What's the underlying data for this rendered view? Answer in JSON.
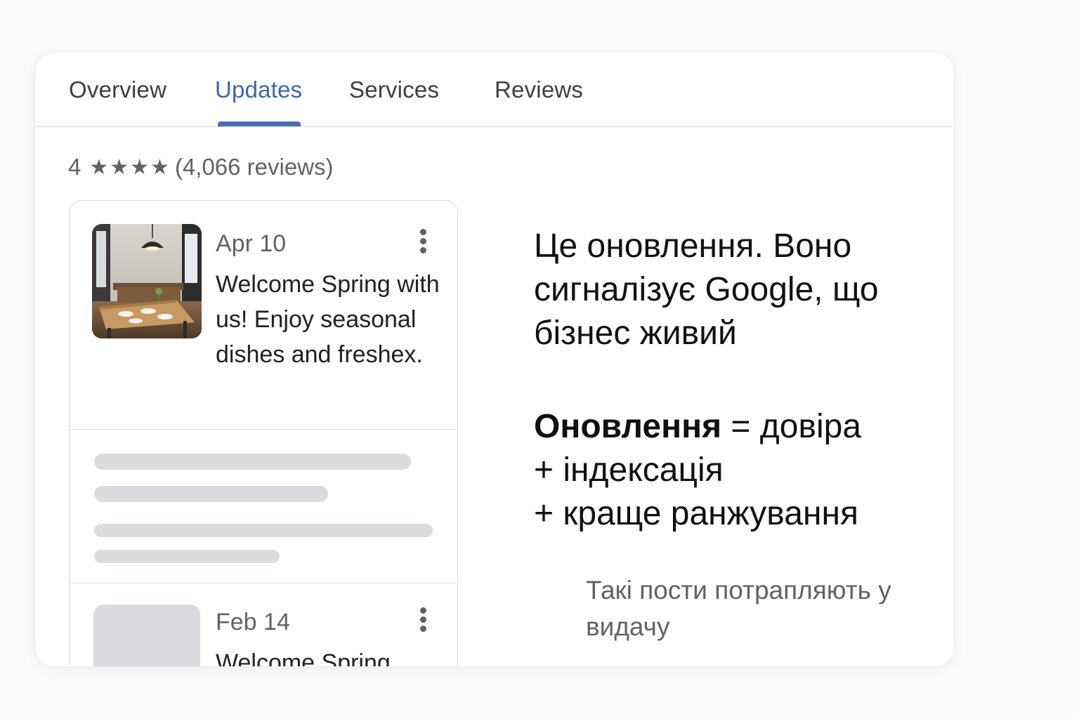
{
  "tabs": [
    {
      "label": "Overview"
    },
    {
      "label": "Updates"
    },
    {
      "label": "Services"
    },
    {
      "label": "Reviews"
    }
  ],
  "active_tab": "Updates",
  "rating": {
    "value": "4",
    "stars": "★★★★",
    "count": "(4,066 reviews)"
  },
  "posts": [
    {
      "date": "Apr 10",
      "text": "Welcome Spring with us! Enjoy seasonal dishes and freshex.",
      "image": "restaurant-interior-photo"
    },
    {
      "date": "Feb 14",
      "text": "Welcome Spring"
    }
  ],
  "annotation": {
    "main": "Це оновлення. Воно сигналізує Google, що бізнес живий",
    "formula_bold": "Оновлення",
    "formula_rest": "= довіра",
    "line2": "+ індексація",
    "line3": "+ краще ранжування",
    "note": "Такі пости потрапляють у видачу"
  },
  "colors": {
    "accent": "#3c66b0",
    "text": "#3c4043",
    "muted": "#5f6368",
    "skeleton": "#dadce0"
  }
}
